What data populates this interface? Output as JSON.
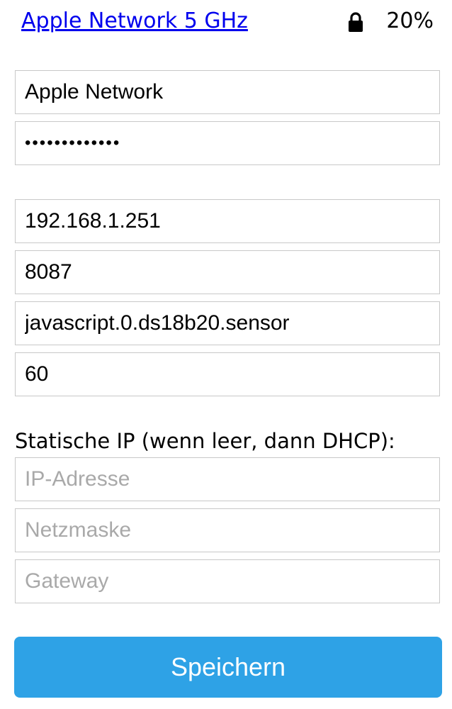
{
  "network": {
    "name": "Apple Network 5 GHz",
    "signal": "20%",
    "icon": "lock-icon"
  },
  "wifi": {
    "ssid": "Apple Network",
    "password": "•••••••••••••"
  },
  "server": {
    "host": "192.168.1.251",
    "port": "8087",
    "state_id": "javascript.0.ds18b20.sensor",
    "interval": "60"
  },
  "static_ip": {
    "label": "Statische IP (wenn leer, dann DHCP):",
    "ip_placeholder": "IP-Adresse",
    "netmask_placeholder": "Netzmaske",
    "gateway_placeholder": "Gateway"
  },
  "actions": {
    "save_label": "Speichern"
  },
  "colors": {
    "link": "#0000ee",
    "button": "#2ea2e6",
    "border": "#c8c8c8",
    "placeholder": "#a9a9a9"
  }
}
